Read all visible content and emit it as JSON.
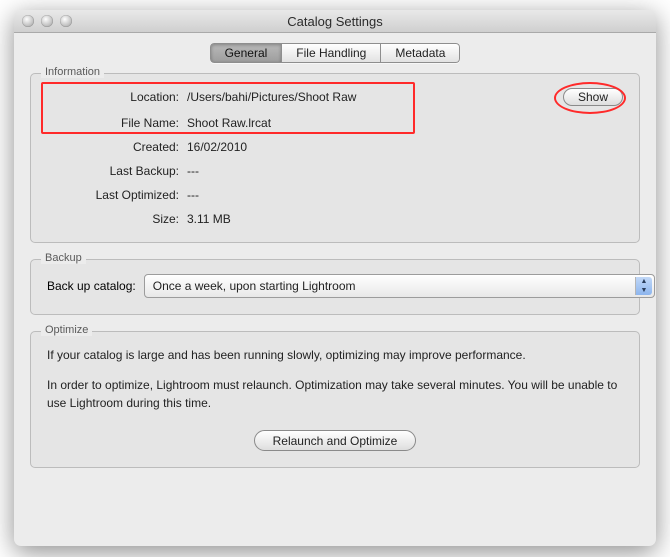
{
  "window": {
    "title": "Catalog Settings"
  },
  "tabs": {
    "general": "General",
    "file_handling": "File Handling",
    "metadata": "Metadata",
    "active": "general"
  },
  "groups": {
    "information": {
      "title": "Information",
      "rows": {
        "location": {
          "label": "Location:",
          "value": "/Users/bahi/Pictures/Shoot Raw"
        },
        "file_name": {
          "label": "File Name:",
          "value": "Shoot Raw.lrcat"
        },
        "created": {
          "label": "Created:",
          "value": "16/02/2010"
        },
        "last_backup": {
          "label": "Last Backup:",
          "value": "---"
        },
        "last_optimized": {
          "label": "Last Optimized:",
          "value": "---"
        },
        "size": {
          "label": "Size:",
          "value": "3.11 MB"
        }
      },
      "show_button": "Show"
    },
    "backup": {
      "title": "Backup",
      "label": "Back up catalog:",
      "selected": "Once a week, upon starting Lightroom"
    },
    "optimize": {
      "title": "Optimize",
      "p1": "If your catalog is large and has been running slowly, optimizing may improve performance.",
      "p2": "In order to optimize, Lightroom must relaunch. Optimization may take several minutes. You will be unable to use Lightroom during this time.",
      "button": "Relaunch and Optimize"
    }
  }
}
